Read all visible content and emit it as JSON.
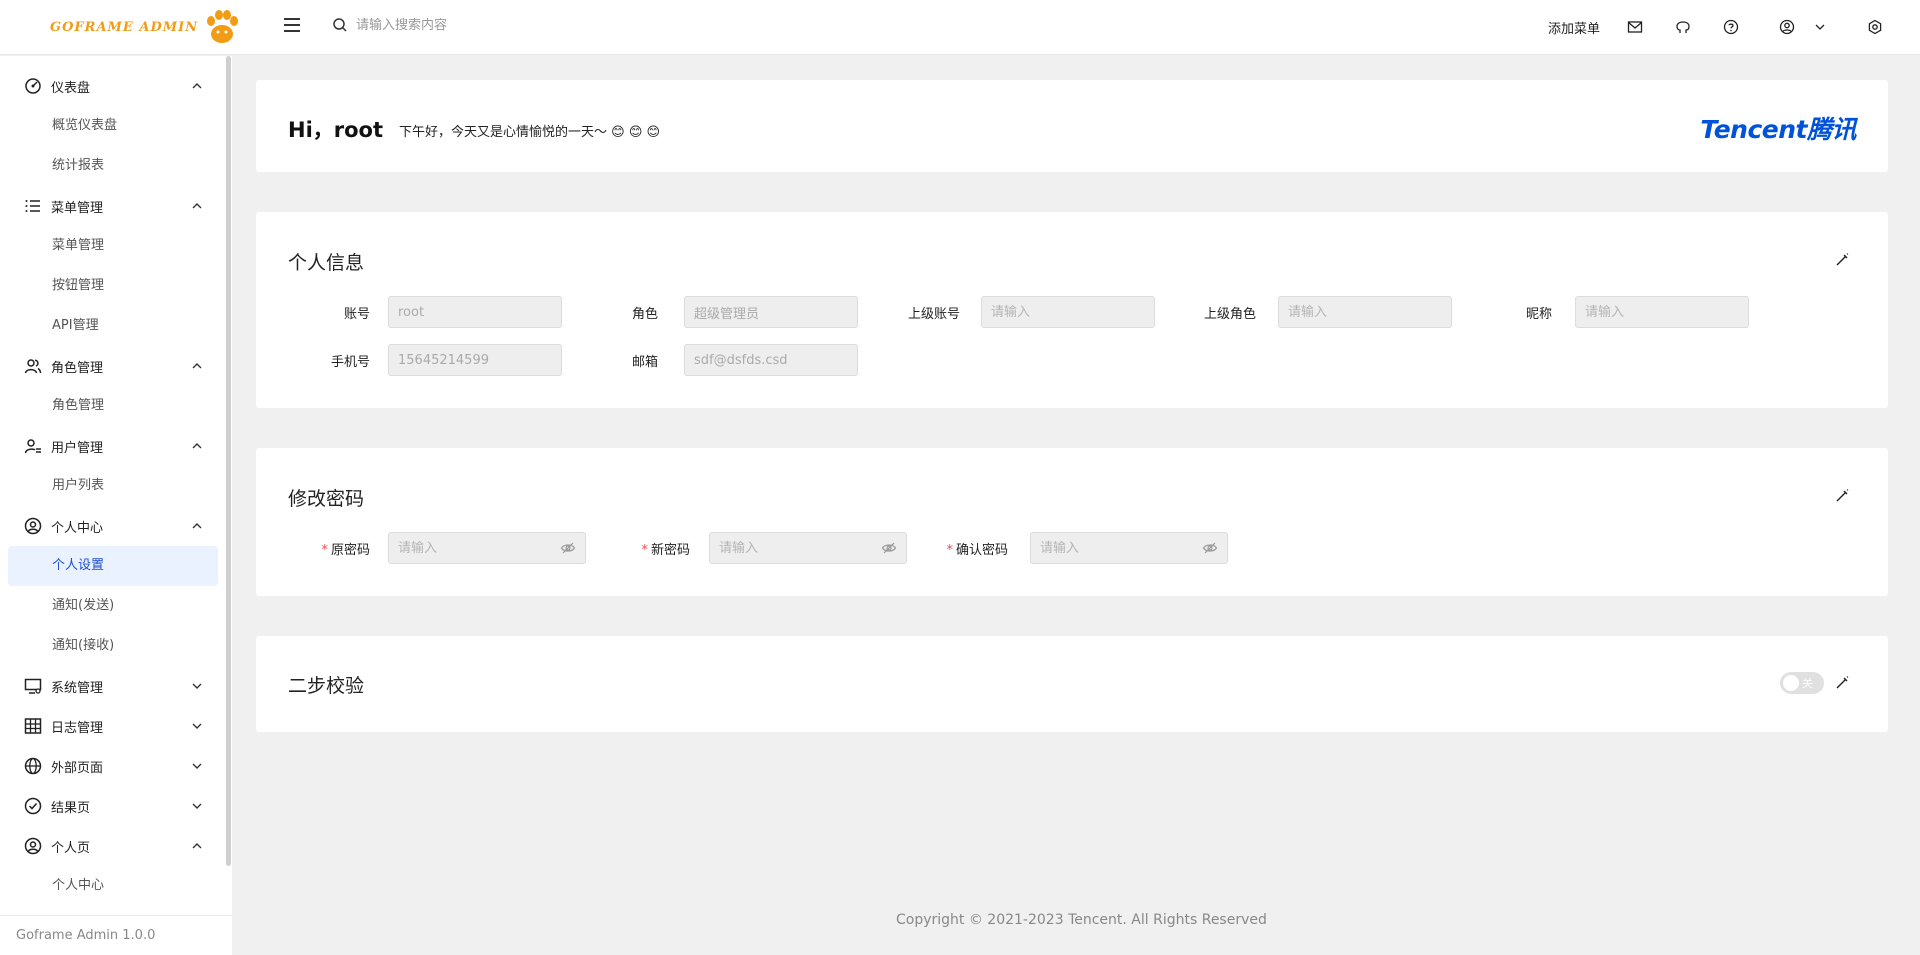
{
  "header": {
    "logo_text": "GOFRAME ADMIN",
    "search_placeholder": "请输入搜索内容",
    "add_menu": "添加菜单",
    "icons": [
      "menu-fold-icon",
      "search-icon",
      "mail-icon",
      "github-icon",
      "help-icon",
      "user-icon",
      "chevron-down-icon",
      "settings-icon"
    ]
  },
  "sidebar": {
    "groups": [
      {
        "label": "仪表盘",
        "icon": "dashboard-icon",
        "open": true,
        "items": [
          "概览仪表盘",
          "统计报表"
        ]
      },
      {
        "label": "菜单管理",
        "icon": "list-icon",
        "open": true,
        "items": [
          "菜单管理",
          "按钮管理",
          "API管理"
        ]
      },
      {
        "label": "角色管理",
        "icon": "usergroup-icon",
        "open": true,
        "items": [
          "角色管理"
        ]
      },
      {
        "label": "用户管理",
        "icon": "user-list-icon",
        "open": true,
        "items": [
          "用户列表"
        ]
      },
      {
        "label": "个人中心",
        "icon": "user-circle-icon",
        "open": true,
        "items": [
          "个人设置",
          "通知(发送)",
          "通知(接收)"
        ]
      },
      {
        "label": "系统管理",
        "icon": "system-icon",
        "open": false,
        "items": []
      },
      {
        "label": "日志管理",
        "icon": "table-icon",
        "open": false,
        "items": []
      },
      {
        "label": "外部页面",
        "icon": "internet-icon",
        "open": false,
        "items": []
      },
      {
        "label": "结果页",
        "icon": "check-circle-icon",
        "open": false,
        "items": []
      },
      {
        "label": "个人页",
        "icon": "user-circle-icon",
        "open": true,
        "items": [
          "个人中心"
        ]
      }
    ],
    "active_item": "个人设置",
    "version": "Goframe Admin 1.0.0"
  },
  "greeting": {
    "title": "Hi，root",
    "message": "下午好，今天又是心情愉悦的一天～",
    "emoji": "😊 😊 😊",
    "brand": "Tencent腾讯"
  },
  "profile": {
    "title": "个人信息",
    "fields": [
      {
        "label": "账号",
        "value": "root",
        "placeholder": ""
      },
      {
        "label": "角色",
        "value": "超级管理员",
        "placeholder": ""
      },
      {
        "label": "上级账号",
        "value": "",
        "placeholder": "请输入"
      },
      {
        "label": "上级角色",
        "value": "",
        "placeholder": "请输入"
      },
      {
        "label": "昵称",
        "value": "",
        "placeholder": "请输入"
      },
      {
        "label": "手机号",
        "value": "15645214599",
        "placeholder": ""
      },
      {
        "label": "邮箱",
        "value": "sdf@dsfds.csd",
        "placeholder": ""
      }
    ]
  },
  "password": {
    "title": "修改密码",
    "required_mark": "*",
    "fields": [
      {
        "label": "原密码",
        "placeholder": "请输入"
      },
      {
        "label": "新密码",
        "placeholder": "请输入"
      },
      {
        "label": "确认密码",
        "placeholder": "请输入"
      }
    ]
  },
  "two_step": {
    "title": "二步校验",
    "toggle_label": "关",
    "enabled": false
  },
  "footer": {
    "copyright": "Copyright © 2021-2023 Tencent. All Rights Reserved"
  }
}
